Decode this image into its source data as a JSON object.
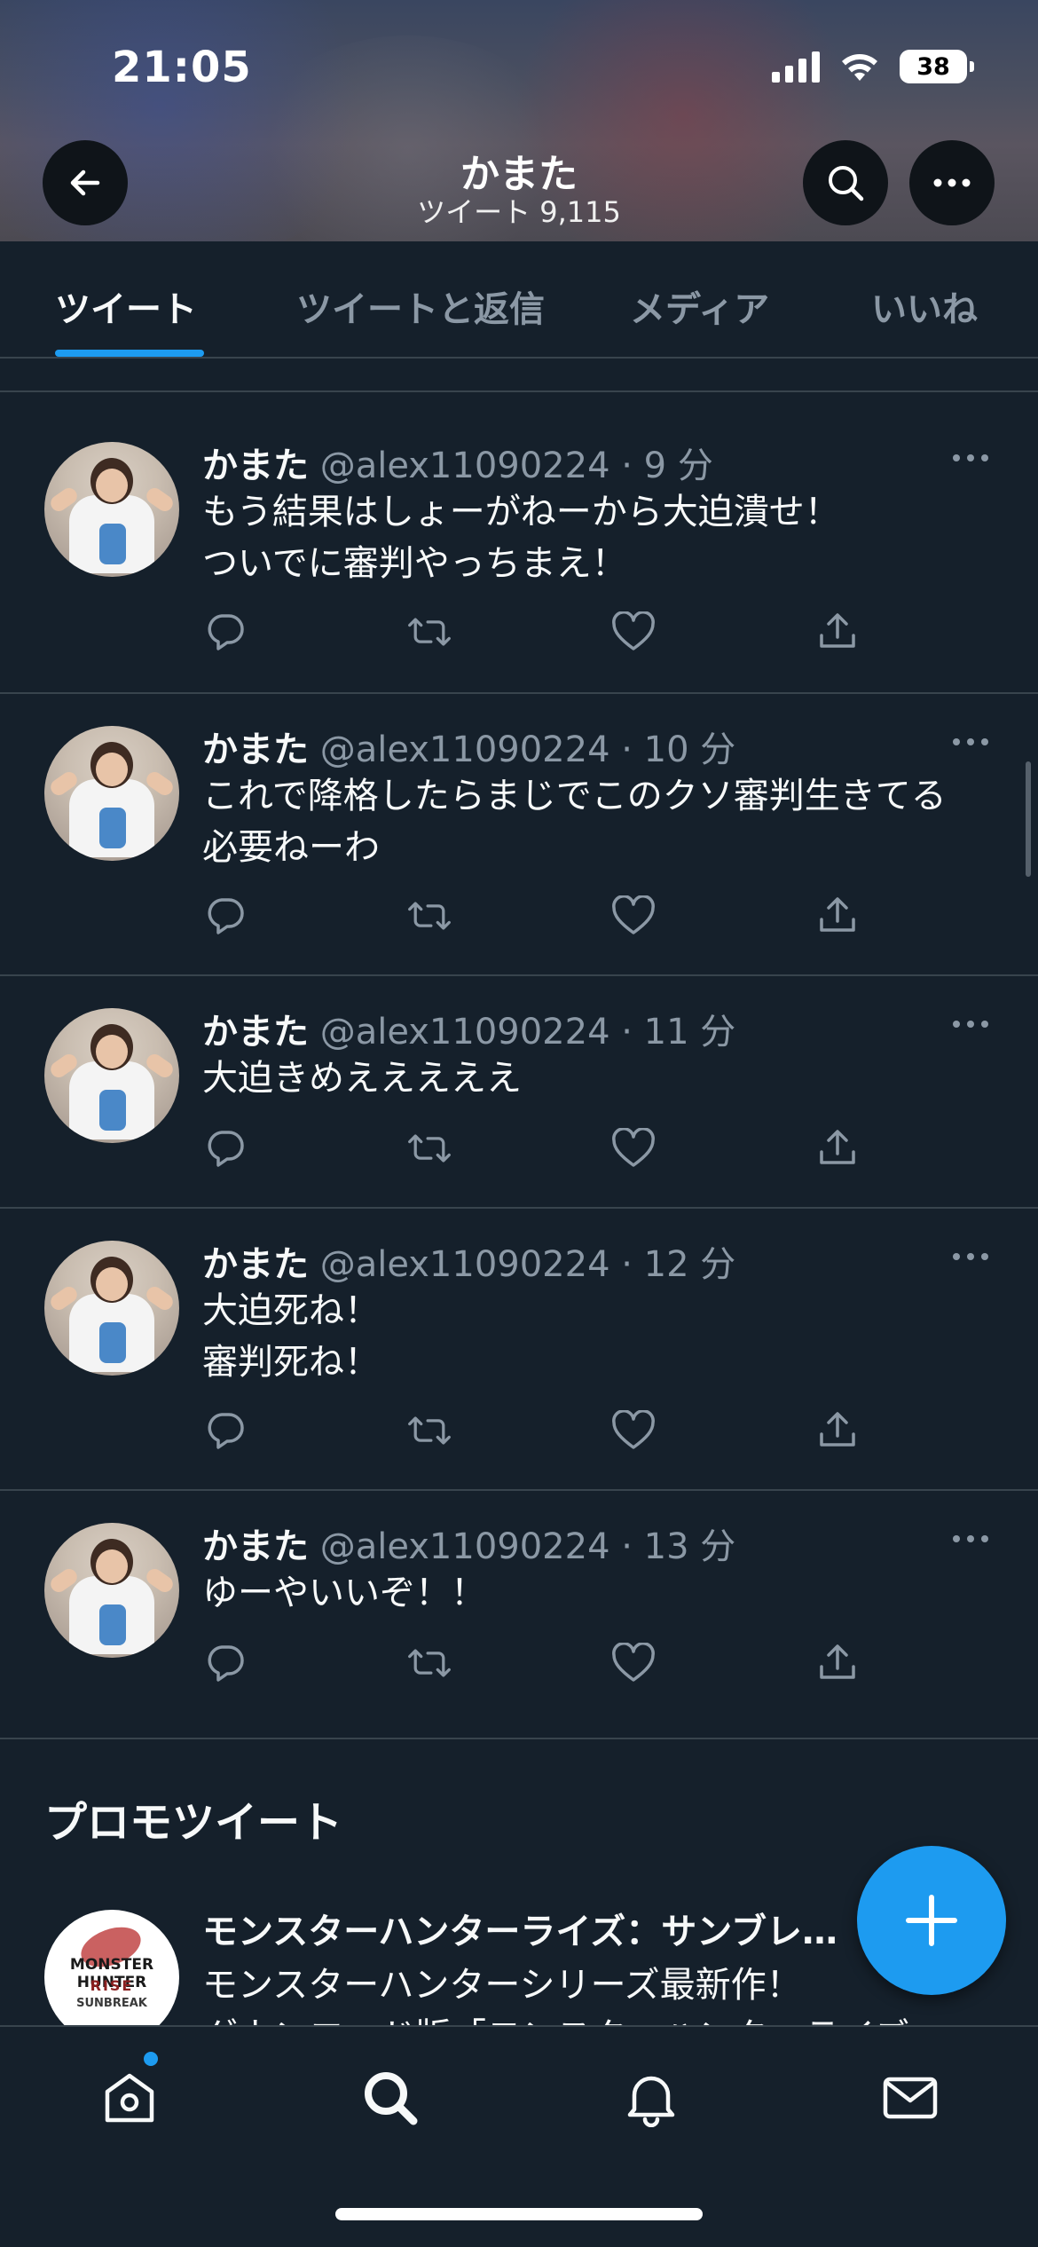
{
  "status_bar": {
    "time": "21:05",
    "battery": "38"
  },
  "header": {
    "title": "かまた",
    "subtitle": "ツイート 9,115"
  },
  "tabs": [
    {
      "label": "ツイート",
      "active": true
    },
    {
      "label": "ツイートと返信",
      "active": false
    },
    {
      "label": "メディア",
      "active": false
    },
    {
      "label": "いいね",
      "active": false
    }
  ],
  "tweets": [
    {
      "name": "かまた",
      "meta": "@alex11090224 · 9 分",
      "text": "もう結果はしょーがねーから大迫潰せ！\nついでに審判やっちまえ！"
    },
    {
      "name": "かまた",
      "meta": "@alex11090224 · 10 分",
      "text": "これで降格したらまじでこのクソ審判生きてる\n必要ねーわ"
    },
    {
      "name": "かまた",
      "meta": "@alex11090224 · 11 分",
      "text": "大迫きめえええええ"
    },
    {
      "name": "かまた",
      "meta": "@alex11090224 · 12 分",
      "text": "大迫死ね！\n審判死ね！"
    },
    {
      "name": "かまた",
      "meta": "@alex11090224 · 13 分",
      "text": "ゆーやいいぞ！！"
    }
  ],
  "promo": {
    "section_title": "プロモツイート",
    "name": "モンスターハンターライズ：サンブレ…",
    "text_line1": "モンスターハンターシリーズ最新作！",
    "text_line2": "ダウンロード版「モンスターハンターライズ：",
    "logo_line1": "MONSTER HUNTER",
    "logo_line2": "RISE",
    "logo_line3": "SUNBREAK"
  },
  "icons": {
    "back": "back-arrow-icon",
    "search": "search-icon",
    "more": "more-icon",
    "reply": "reply-icon",
    "retweet": "retweet-icon",
    "like": "heart-icon",
    "share": "share-icon",
    "compose": "plus-icon",
    "nav_home": "home-icon",
    "nav_search": "search-icon",
    "nav_notifications": "bell-icon",
    "nav_messages": "mail-icon"
  },
  "colors": {
    "background": "#15202b",
    "accent": "#1d9bf0",
    "secondary_text": "#8b98a5",
    "divider": "#38444d"
  }
}
